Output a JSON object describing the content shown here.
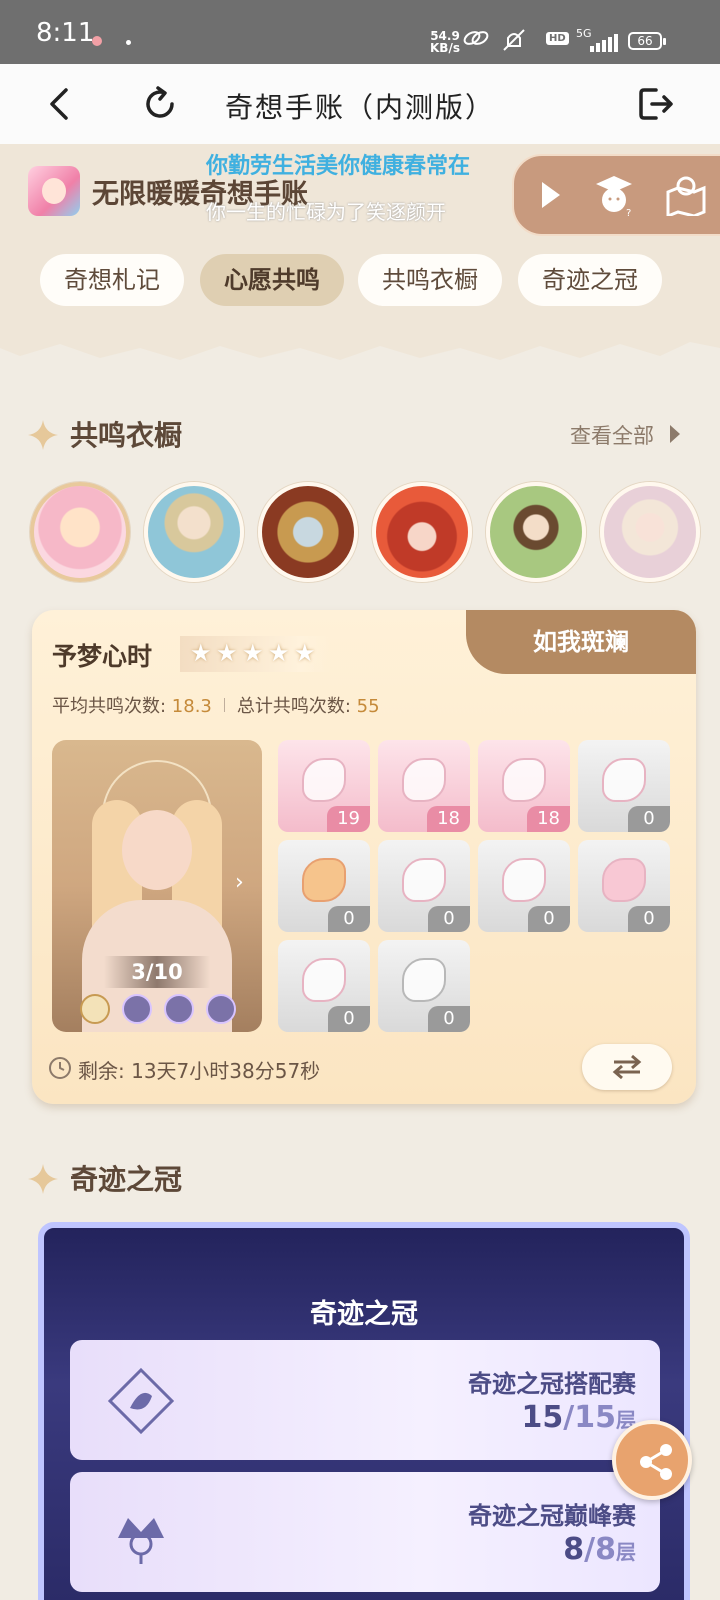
{
  "status_bar": {
    "time": "8:11",
    "speed_value": "54.9",
    "speed_unit": "KB/s",
    "network": "5G",
    "hd": "HD",
    "battery": "66"
  },
  "app_bar": {
    "title": "奇想手账（内测版）",
    "icons": [
      "back-icon",
      "refresh-icon",
      "exit-icon"
    ]
  },
  "header": {
    "brand": "无限暖暖奇想手账",
    "lyric_line_1": "你勤劳生活美你健康春常在",
    "lyric_line_2": "你一生的忙碌为了笑逐颜开"
  },
  "tabs": [
    {
      "label": "奇想札记",
      "active": false
    },
    {
      "label": "心愿共鸣",
      "active": true
    },
    {
      "label": "共鸣衣橱",
      "active": false
    },
    {
      "label": "奇迹之冠",
      "active": false
    }
  ],
  "wardrobe_section": {
    "title": "共鸣衣橱",
    "view_all": "查看全部"
  },
  "outfit_card": {
    "title": "予梦心时",
    "star_count": 5,
    "ribbon": "如我斑斓",
    "avg_label": "平均共鸣次数: ",
    "avg_value": "18.3",
    "total_label": "总计共鸣次数: ",
    "total_value": "55",
    "progress": "3/10",
    "remaining": "剩余: 13天7小时38分57秒",
    "item_counts": [
      "19",
      "18",
      "18",
      "0",
      "0",
      "0",
      "0",
      "0",
      "0",
      "0"
    ]
  },
  "crown_section": {
    "title": "奇迹之冠",
    "banner_title": "奇迹之冠",
    "rows": [
      {
        "name": "奇迹之冠搭配赛",
        "current": "15",
        "total": "15",
        "unit": "层"
      },
      {
        "name": "奇迹之冠巅峰赛",
        "current": "8",
        "total": "8",
        "unit": "层"
      }
    ]
  },
  "colors": {
    "background": "#f1ece3",
    "accent_brown": "#b48a62",
    "active_tab": "#dfcfb2",
    "crown_blue": "#2a2a66",
    "share_orange": "#e8a36e"
  }
}
